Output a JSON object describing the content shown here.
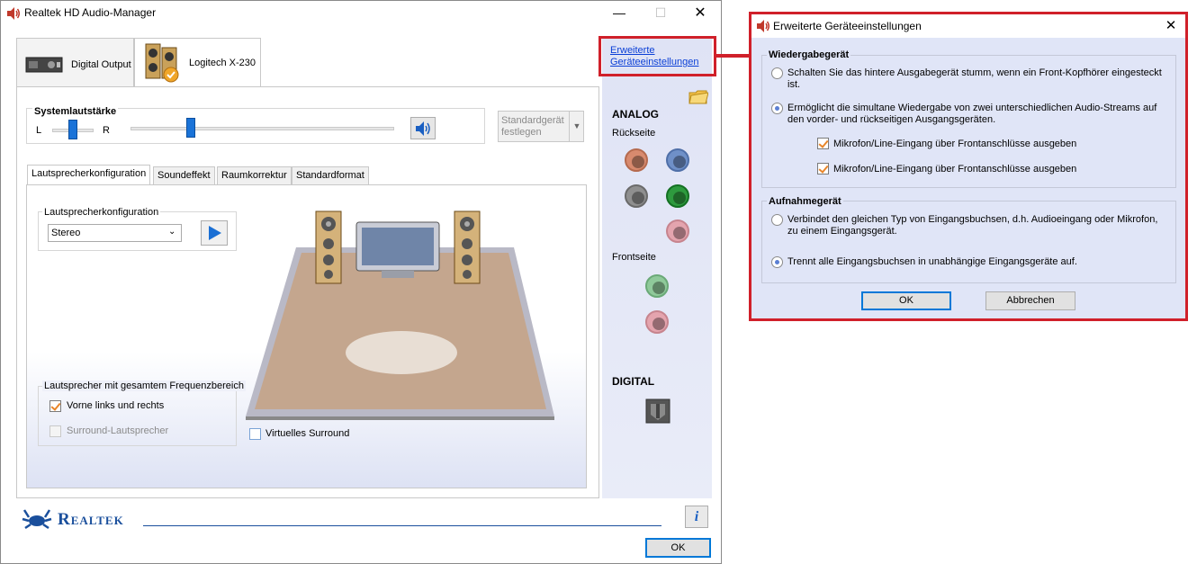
{
  "main_window": {
    "title": "Realtek HD Audio-Manager",
    "device_tabs": [
      {
        "label": "Digital Output"
      },
      {
        "label": "Logitech X-230"
      }
    ],
    "advanced_link_line1": "Erweiterte",
    "advanced_link_line2": "Geräteeinstellungen",
    "system_volume": {
      "label": "Systemlautstärke",
      "left": "L",
      "right": "R",
      "balance": 0.5,
      "volume": 0.23
    },
    "default_device_button": "Standardgerät festlegen",
    "subtabs": [
      "Lautsprecherkonfiguration",
      "Soundeffekt",
      "Raumkorrektur",
      "Standardformat"
    ],
    "speaker_config": {
      "group_label": "Lautsprecherkonfiguration",
      "selected": "Stereo"
    },
    "fullrange": {
      "group_label": "Lautsprecher mit gesamtem Frequenzbereich",
      "front_label": "Vorne links und rechts",
      "front_checked": true,
      "surround_label": "Surround-Lautsprecher",
      "surround_checked": false
    },
    "virtual_surround": {
      "label": "Virtuelles Surround",
      "checked": false
    },
    "right_panel": {
      "analog": "ANALOG",
      "rear": "Rückseite",
      "front": "Frontseite",
      "digital": "DIGITAL"
    },
    "brand": "Realtek",
    "ok_label": "OK"
  },
  "dialog": {
    "title": "Erweiterte Geräteeinstellungen",
    "playback": {
      "heading": "Wiedergabegerät",
      "option1": "Schalten Sie das hintere Ausgabegerät stumm, wenn ein Front-Kopfhörer eingesteckt ist.",
      "option1_checked": false,
      "option2": "Ermöglicht die simultane Wiedergabe von zwei unterschiedlichen Audio-Streams auf den vorder- und rückseitigen Ausgangsgeräten.",
      "option2_checked": true,
      "check1": "Mikrofon/Line-Eingang über Frontanschlüsse ausgeben",
      "check1_checked": true,
      "check2": "Mikrofon/Line-Eingang über Frontanschlüsse ausgeben",
      "check2_checked": true
    },
    "recording": {
      "heading": "Aufnahmegerät",
      "option1": "Verbindet den gleichen Typ von Eingangsbuchsen, d.h. Audioeingang oder Mikrofon, zu einem Eingangsgerät.",
      "option1_checked": false,
      "option2": "Trennt alle Eingangsbuchsen in unabhängige Eingangsgeräte auf.",
      "option2_checked": true
    },
    "ok_label": "OK",
    "cancel_label": "Abbrechen"
  },
  "colors": {
    "highlight_frame": "#d0202a",
    "accent_blue": "#1a73d8",
    "link": "#0a3fd6"
  },
  "icons": {
    "app": "speaker-icon",
    "close": "close-icon",
    "minimize": "minimize-icon",
    "maximize": "maximize-icon",
    "info": "info-icon",
    "folder": "folder-icon",
    "play": "play-icon",
    "dropdown": "chevron-down-icon"
  }
}
